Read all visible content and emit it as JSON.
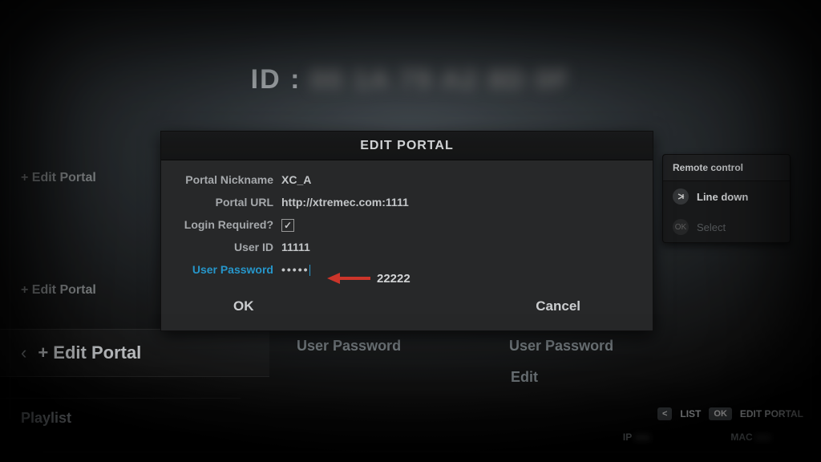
{
  "banner": {
    "id_prefix": "ID :",
    "id_masked": "00 1A 79 A2 8D 0F"
  },
  "sidebar": {
    "item1": "+ Edit Portal",
    "item2": "+ Edit Portal",
    "highlight": {
      "chevron": "‹",
      "label": "+ Edit Portal"
    },
    "playlist": "Playlist"
  },
  "dialog": {
    "title": "EDIT PORTAL",
    "labels": {
      "nickname": "Portal Nickname",
      "url": "Portal URL",
      "login": "Login Required?",
      "userid": "User ID",
      "password": "User Password"
    },
    "values": {
      "nickname": "XC_A",
      "url": "http://xtremec.com:1111",
      "login_checked": true,
      "userid": "11111",
      "password_mask": "•••••"
    },
    "buttons": {
      "ok": "OK",
      "cancel": "Cancel"
    }
  },
  "annotation": {
    "password_hint": "22222"
  },
  "background": {
    "user_password": "User Password",
    "edit": "Edit"
  },
  "remote": {
    "title": "Remote control",
    "line_down": "Line down",
    "select": "Select"
  },
  "footer": {
    "list_key": "<",
    "list_label": "LIST",
    "ok_key": "OK",
    "edit_label": "EDIT PORTAL",
    "ip_label": "IP",
    "mac_label": "MAC"
  }
}
